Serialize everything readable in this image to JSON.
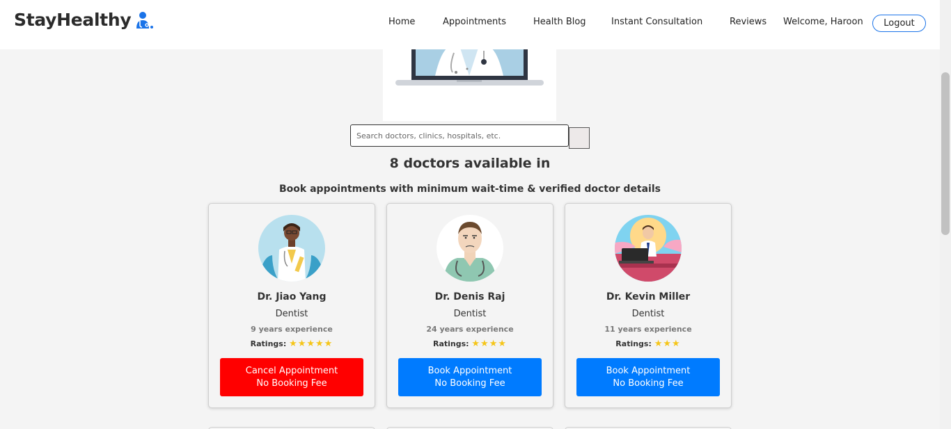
{
  "brand": {
    "name": "StayHealthy",
    "icon": "doctor-icon",
    "accent": "#1a73e8"
  },
  "nav": {
    "items": [
      "Home",
      "Appointments",
      "Health Blog",
      "Instant Consultation",
      "Reviews"
    ],
    "welcome": "Welcome, Haroon",
    "logout_label": "Logout"
  },
  "search": {
    "placeholder": "Search doctors, clinics, hospitals, etc."
  },
  "results": {
    "title": "8 doctors available in",
    "subtitle": "Book appointments with minimum wait-time & verified doctor details"
  },
  "doctors": [
    {
      "name": "Dr. Jiao Yang",
      "speciality": "Dentist",
      "experience": "9 years experience",
      "ratings_label": "Ratings:",
      "rating": 5,
      "button_line1": "Cancel Appointment",
      "button_line2": "No Booking Fee",
      "button_color": "#ff0000"
    },
    {
      "name": "Dr. Denis Raj",
      "speciality": "Dentist",
      "experience": "24 years experience",
      "ratings_label": "Ratings:",
      "rating": 4,
      "button_line1": "Book Appointment",
      "button_line2": "No Booking Fee",
      "button_color": "#007bff"
    },
    {
      "name": "Dr. Kevin Miller",
      "speciality": "Dentist",
      "experience": "11 years experience",
      "ratings_label": "Ratings:",
      "rating": 3,
      "button_line1": "Book Appointment",
      "button_line2": "No Booking Fee",
      "button_color": "#007bff"
    }
  ]
}
